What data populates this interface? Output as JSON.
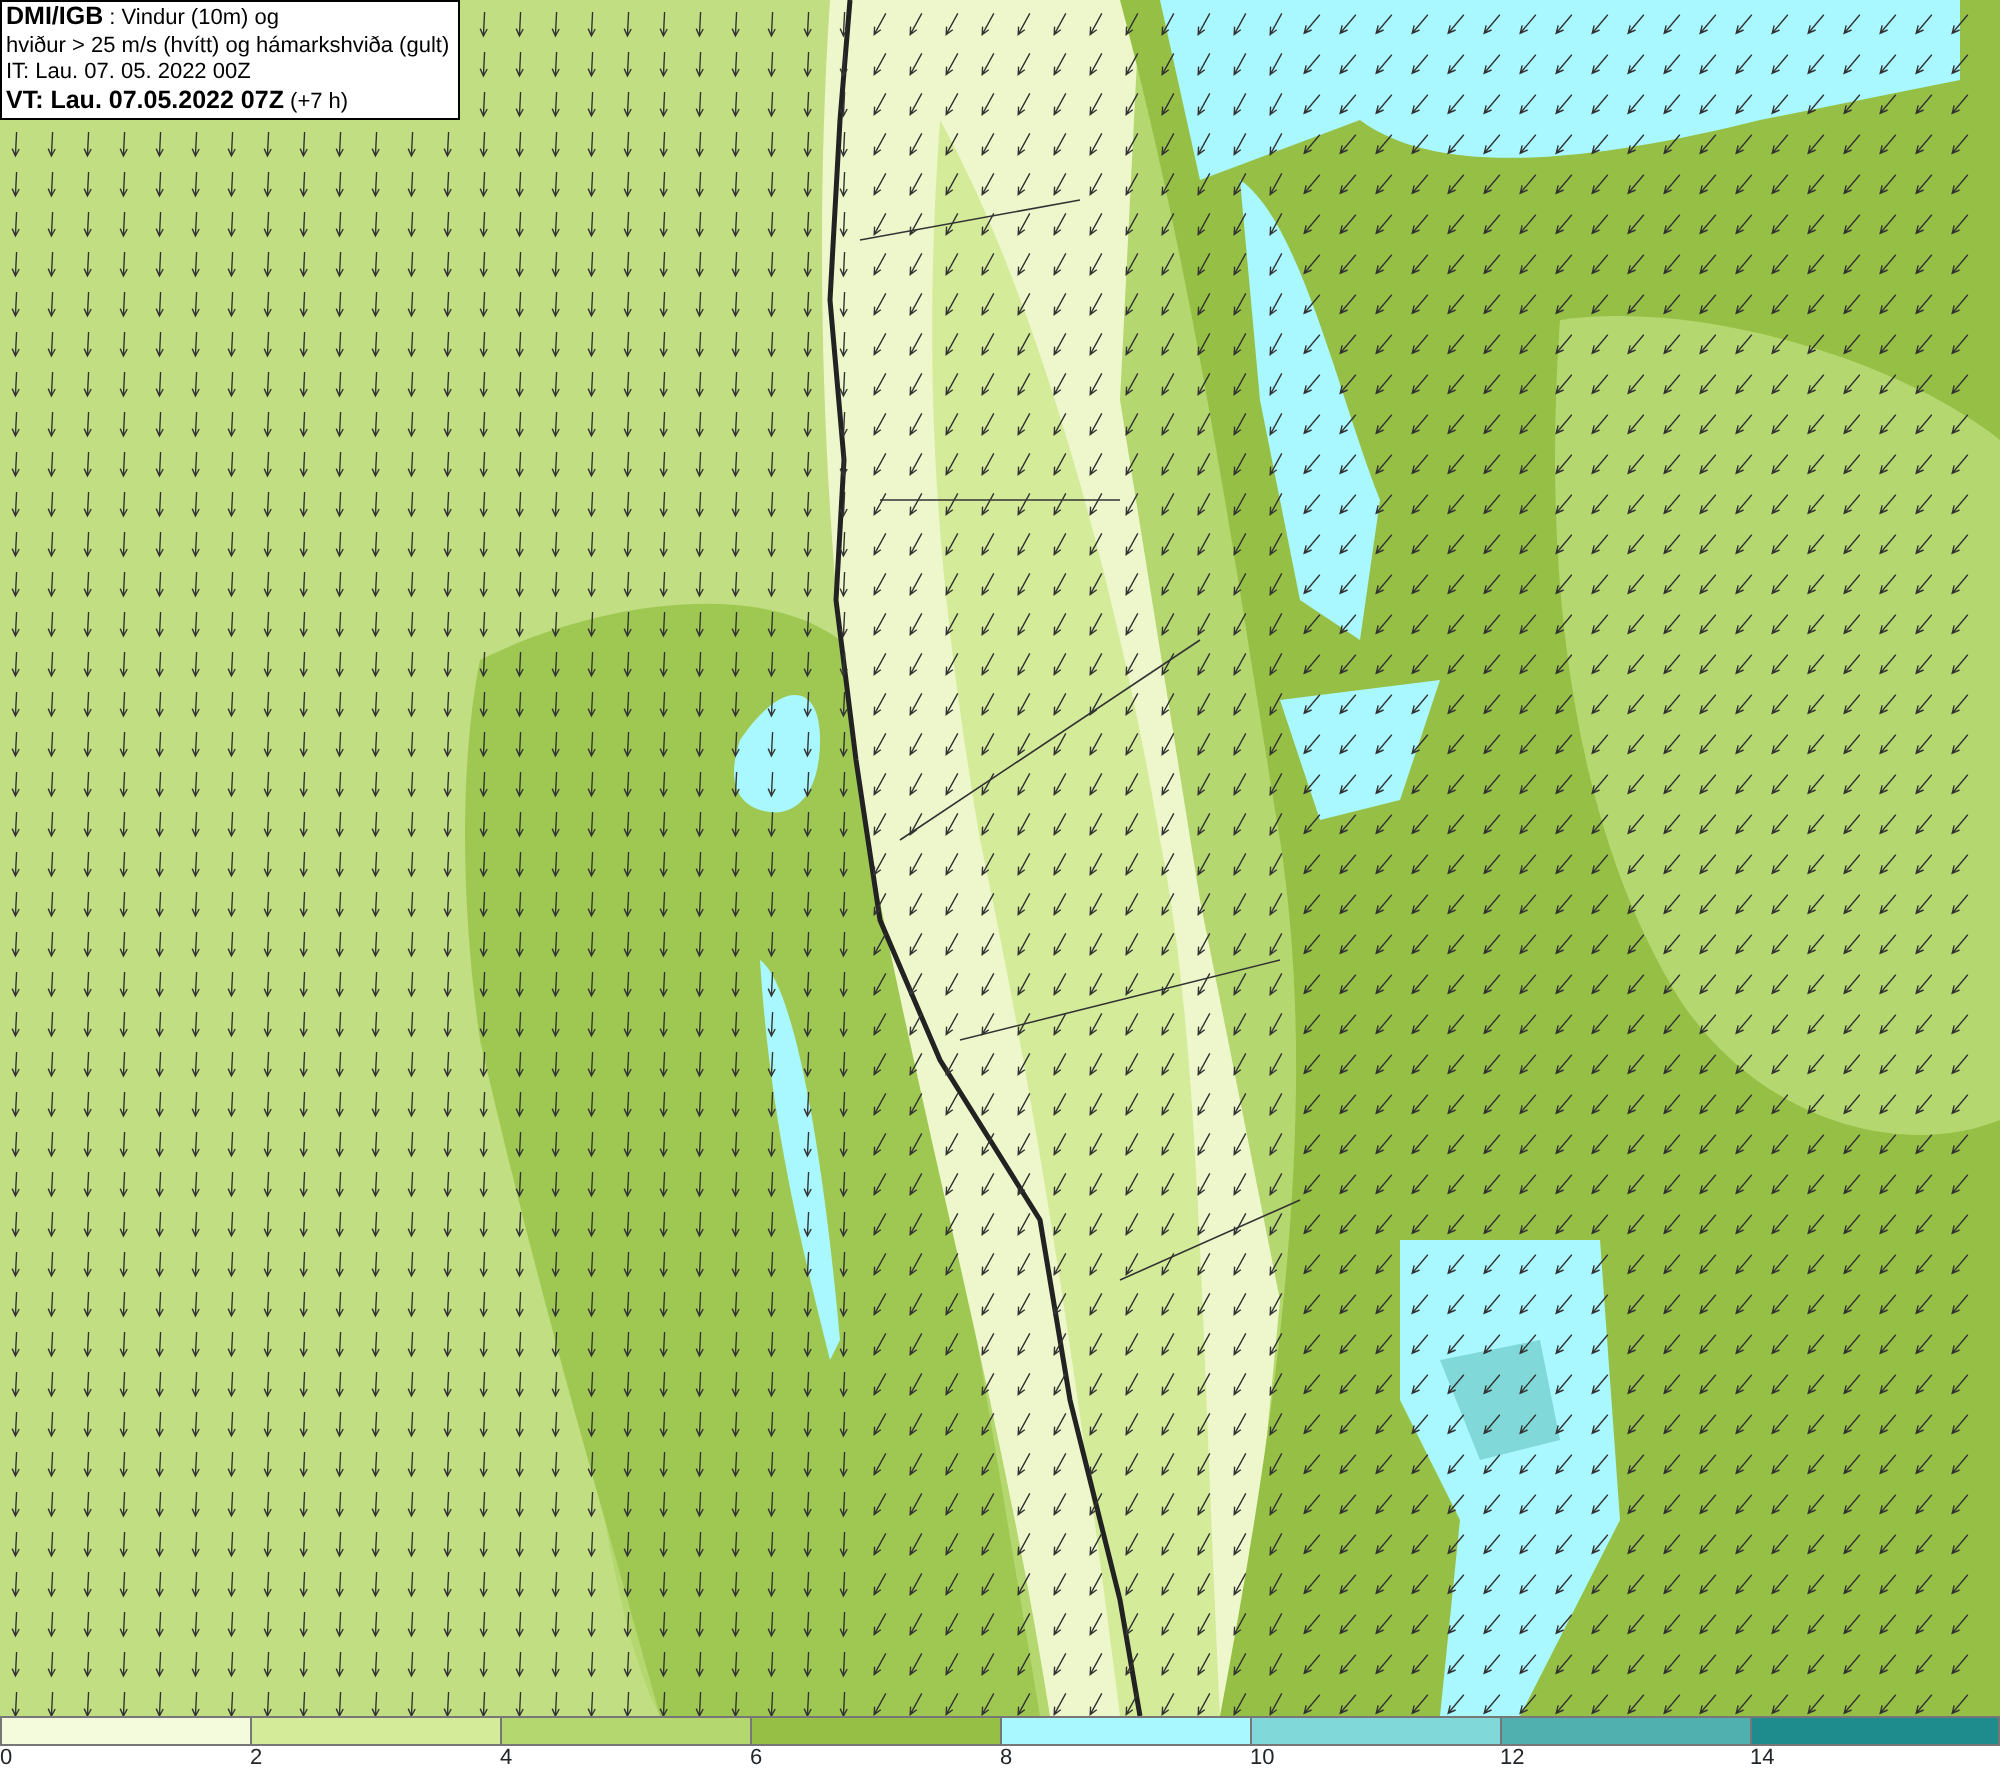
{
  "title_box": {
    "lines": [
      "**DMI/IGB** : Vindur (10m) og",
      "hviður > 25 m/s (hvítt) og hámarkshviða (gult)",
      "IT: Lau. 07. 05. 2022 00Z",
      "**VT: Lau. 07.05.2022 07Z** (+7 h)"
    ]
  },
  "legend": [
    {
      "label": "0",
      "color": "#f4fbdc"
    },
    {
      "label": "2",
      "color": "#d4ec9a"
    },
    {
      "label": "4",
      "color": "#b5d770"
    },
    {
      "label": "6",
      "color": "#96c045"
    },
    {
      "label": "8",
      "color": "#aaf8ff"
    },
    {
      "label": "10",
      "color": "#80d8d8"
    },
    {
      "label": "12",
      "color": "#50b0b0"
    },
    {
      "label": "14",
      "color": "#1e8c8c"
    }
  ]
}
